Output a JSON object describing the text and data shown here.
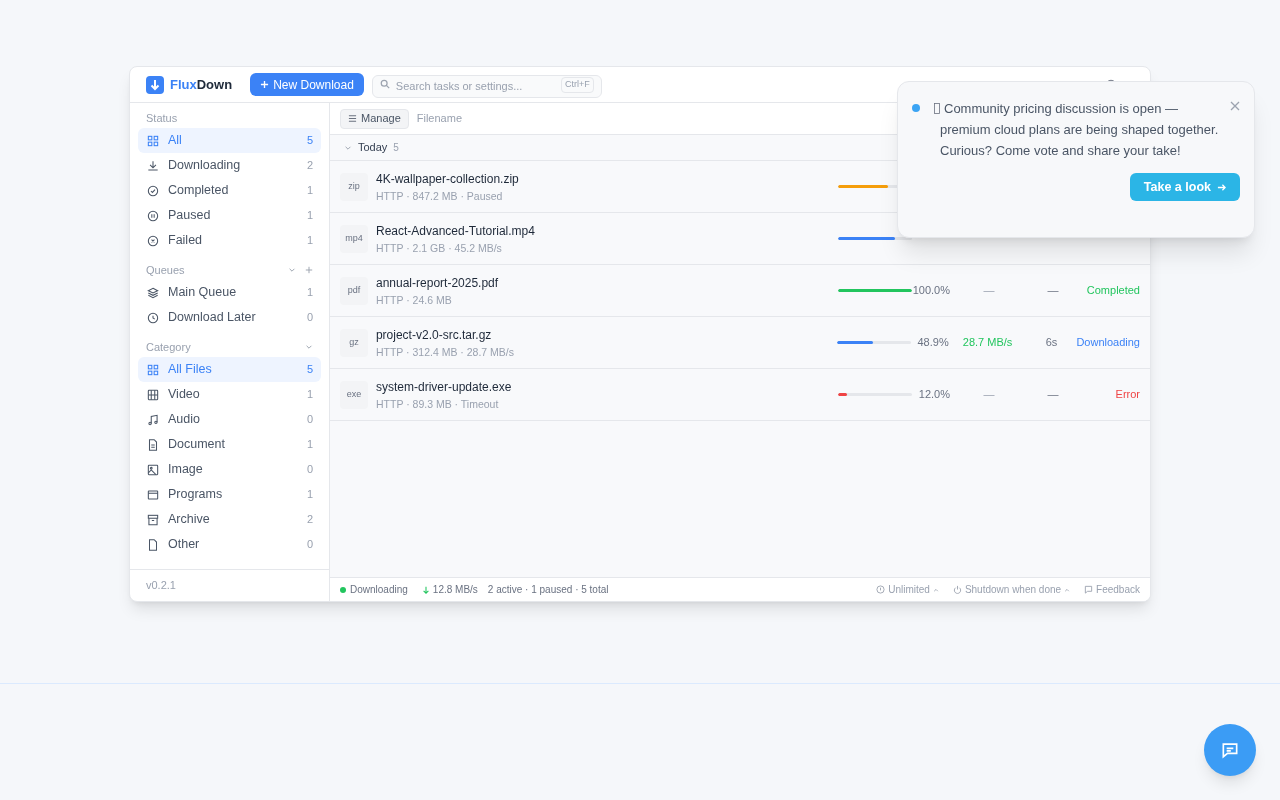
{
  "app": {
    "logo_first": "Flux",
    "logo_second": "Down",
    "new_button": "New Download",
    "search_placeholder": "Search tasks or settings...",
    "search_shortcut": "Ctrl+F"
  },
  "sidebar": {
    "sections": [
      {
        "title": "Status",
        "items": [
          {
            "label": "All",
            "count": "5",
            "selected": true
          },
          {
            "label": "Downloading",
            "count": "2",
            "selected": false
          },
          {
            "label": "Completed",
            "count": "1",
            "selected": false
          },
          {
            "label": "Paused",
            "count": "1",
            "selected": false
          },
          {
            "label": "Failed",
            "count": "1",
            "selected": false
          }
        ]
      },
      {
        "title": "Queues",
        "items": [
          {
            "label": "Main Queue",
            "count": "1",
            "selected": false
          },
          {
            "label": "Download Later",
            "count": "0",
            "selected": false
          }
        ]
      },
      {
        "title": "Category",
        "items": [
          {
            "label": "All Files",
            "count": "5",
            "selected": true
          },
          {
            "label": "Video",
            "count": "1",
            "selected": false
          },
          {
            "label": "Audio",
            "count": "0",
            "selected": false
          },
          {
            "label": "Document",
            "count": "1",
            "selected": false
          },
          {
            "label": "Image",
            "count": "0",
            "selected": false
          },
          {
            "label": "Programs",
            "count": "1",
            "selected": false
          },
          {
            "label": "Archive",
            "count": "2",
            "selected": false
          },
          {
            "label": "Other",
            "count": "0",
            "selected": false
          }
        ]
      }
    ],
    "version": "v0.2.1"
  },
  "toolbar": {
    "manage": "Manage",
    "filename": "Filename"
  },
  "group": {
    "label": "Today",
    "count": "5",
    "expanded": true
  },
  "rows": [
    {
      "ext": "zip",
      "name": "4K-wallpaper-collection.zip",
      "meta": "HTTP · 847.2 MB · Paused",
      "level": 0.67,
      "color": "#f59e0b",
      "kind": "paused"
    },
    {
      "ext": "mp4",
      "name": "React-Advanced-Tutorial.mp4",
      "meta": "HTTP · 2.1 GB · 45.2 MB/s",
      "level": 0.77,
      "color": "#3b82f6",
      "kind": "downloading"
    },
    {
      "ext": "pdf",
      "name": "annual-report-2025.pdf",
      "meta": "HTTP · 24.6 MB",
      "level": 1.0,
      "color": "#22c55e",
      "percent": "100.0%",
      "speed": "—",
      "eta": "—",
      "status": "Completed",
      "kind": "completed"
    },
    {
      "ext": "gz",
      "name": "project-v2.0-src.tar.gz",
      "meta": "HTTP · 312.4 MB · 28.7 MB/s",
      "level": 0.489,
      "color": "#3b82f6",
      "percent": "48.9%",
      "speed": "28.7 MB/s",
      "eta": "6s",
      "status": "Downloading",
      "kind": "downloading"
    },
    {
      "ext": "exe",
      "name": "system-driver-update.exe",
      "meta": "HTTP · 89.3 MB · Timeout",
      "level": 0.12,
      "color": "#ef4444",
      "percent": "12.0%",
      "speed": "—",
      "eta": "—",
      "status": "Error",
      "kind": "error"
    }
  ],
  "status_bar": {
    "state": "Downloading",
    "speed": "12.8 MB/s",
    "summary": "2 active · 1 paused · 5 total",
    "limit": "Unlimited",
    "shutdown": "Shutdown when done",
    "feedback": "Feedback"
  },
  "notice": {
    "text": "Community pricing discussion is open — premium cloud plans are being shaped together. Curious? Come vote and share your take!",
    "button": "Take a look"
  }
}
